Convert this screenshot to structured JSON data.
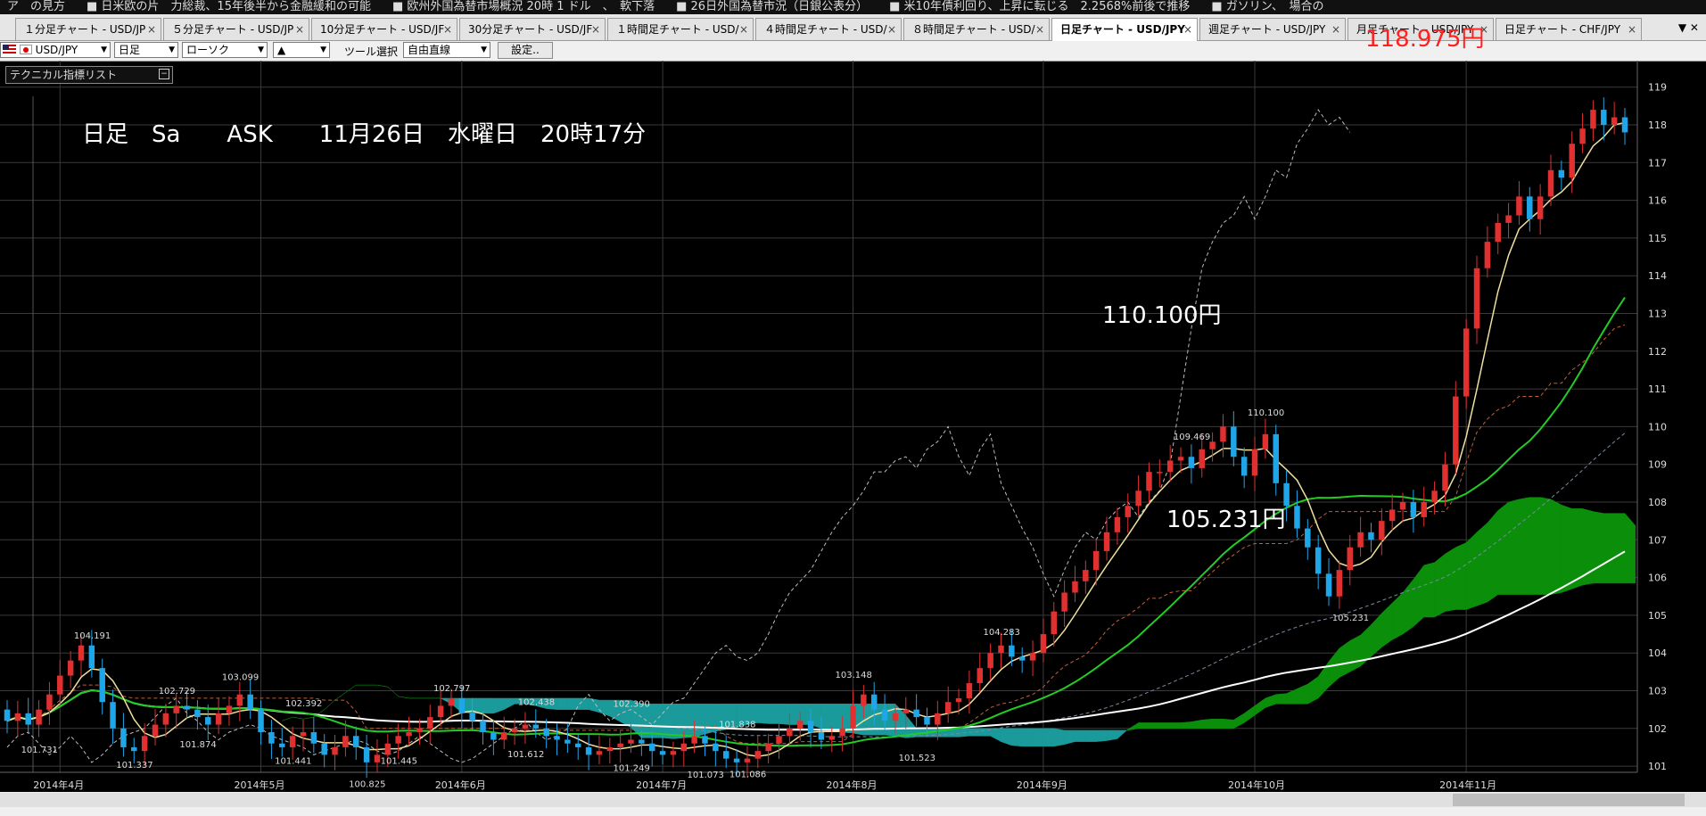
{
  "ticker": [
    "ア　の見方",
    "■ 日米欧の片　力総裁、15年後半から金融緩和の可能",
    "■ 欧州外国為替市場概況 20時 1 ドル　、　軟下落",
    "■ 26日外国為替市況（日銀公表分）",
    "■ 米10年債利回り、上昇に転じる　2.2568%前後で推移",
    "■ ガソリン、　場合の"
  ],
  "tabs": [
    {
      "label": "１分足チャート - USD/JP",
      "active": false
    },
    {
      "label": "５分足チャート - USD/JP",
      "active": false
    },
    {
      "label": "10分足チャート - USD/JF",
      "active": false
    },
    {
      "label": "30分足チャート - USD/JF",
      "active": false
    },
    {
      "label": "１時間足チャート - USD/",
      "active": false
    },
    {
      "label": "４時間足チャート - USD/",
      "active": false
    },
    {
      "label": "８時間足チャート - USD/",
      "active": false
    },
    {
      "label": "日足チャート - USD/JPY",
      "active": true
    },
    {
      "label": "週足チャート - USD/JPY",
      "active": false
    },
    {
      "label": "月足チャート - USD/JPY",
      "active": false
    },
    {
      "label": "日足チャート - CHF/JPY",
      "active": false
    }
  ],
  "tab_close": "×",
  "tab_controls": "▼ ✕",
  "toolbar": {
    "pair": "USD/JPY",
    "period": "日足",
    "chart_kind": "ローソク",
    "style_icon": "▲",
    "tool_label": "ツール選択",
    "tool_value": "自由直線",
    "settings": "設定.."
  },
  "current_price_text": "118.975円",
  "indicator_list": "テクニカル指標リスト",
  "info_line": "日足　Sa　　ASK　　11月26日　水曜日　20時17分",
  "annotations": {
    "high_text": "110.100円",
    "low_text": "105.231円"
  },
  "colors": {
    "background": "#000000",
    "grid": "#3a3a3a",
    "up_candle": "#e03030",
    "down_candle": "#1ea6e8",
    "cloud_green": "#0b8f0b",
    "cloud_teal": "#1a9a9a",
    "ma_short": "#f0e0a0",
    "ma_mid": "#22cc22",
    "ma_long": "#ffffff",
    "current_price": "#ff2020"
  },
  "chart_data": {
    "type": "candlestick",
    "symbol": "USD/JPY",
    "timeframe": "日足",
    "ylim": [
      100.6,
      119.3
    ],
    "yticks": [
      101,
      102,
      103,
      104,
      105,
      106,
      107,
      108,
      109,
      110,
      111,
      112,
      113,
      114,
      115,
      116,
      117,
      118,
      119
    ],
    "month_labels": [
      "2014年4月",
      "2014年5月",
      "2014年6月",
      "2014年7月",
      "2014年8月",
      "2014年9月",
      "2014年10月",
      "2014年11月"
    ],
    "month_start_index": [
      5,
      24,
      43,
      62,
      80,
      98,
      118,
      138
    ],
    "close": [
      102.2,
      102.4,
      102.1,
      102.5,
      102.9,
      103.4,
      103.8,
      104.2,
      103.6,
      102.7,
      102.0,
      101.5,
      101.4,
      101.8,
      102.1,
      102.4,
      102.6,
      102.5,
      102.3,
      102.1,
      102.4,
      102.6,
      102.9,
      102.5,
      101.9,
      101.6,
      101.5,
      101.8,
      101.9,
      101.6,
      101.3,
      101.5,
      101.8,
      101.5,
      101.1,
      101.3,
      101.6,
      101.8,
      101.9,
      102.0,
      102.3,
      102.6,
      102.8,
      102.4,
      102.2,
      101.9,
      101.7,
      101.9,
      102.0,
      102.1,
      102.0,
      101.8,
      101.7,
      101.6,
      101.5,
      101.3,
      101.4,
      101.5,
      101.6,
      101.7,
      101.6,
      101.4,
      101.3,
      101.4,
      101.6,
      101.8,
      101.6,
      101.4,
      101.2,
      101.1,
      101.2,
      101.4,
      101.6,
      101.8,
      102.0,
      102.2,
      101.9,
      101.7,
      101.8,
      102.0,
      102.6,
      102.9,
      102.5,
      102.2,
      102.4,
      102.5,
      102.3,
      102.1,
      102.4,
      102.7,
      102.8,
      103.2,
      103.6,
      104.0,
      104.2,
      103.9,
      103.8,
      104.0,
      104.5,
      105.1,
      105.6,
      105.9,
      106.2,
      106.7,
      107.2,
      107.6,
      107.9,
      108.3,
      108.8,
      108.8,
      109.1,
      109.2,
      108.9,
      109.4,
      109.6,
      110.0,
      109.2,
      108.7,
      109.4,
      109.8,
      108.5,
      107.9,
      107.3,
      106.8,
      106.1,
      105.5,
      106.2,
      106.8,
      107.2,
      107.0,
      107.5,
      107.8,
      108.0,
      107.6,
      108.0,
      108.3,
      109.0,
      110.8,
      112.6,
      114.2,
      114.9,
      115.4,
      115.6,
      116.1,
      115.5,
      116.1,
      116.8,
      116.6,
      117.5,
      117.9,
      118.4,
      118.0,
      118.2,
      117.8
    ],
    "open": [
      102.5,
      102.2,
      102.4,
      102.1,
      102.5,
      102.9,
      103.4,
      103.8,
      104.2,
      103.6,
      102.7,
      102.0,
      101.5,
      101.4,
      101.8,
      102.1,
      102.4,
      102.6,
      102.5,
      102.3,
      102.1,
      102.4,
      102.6,
      102.9,
      102.5,
      101.9,
      101.6,
      101.5,
      101.8,
      101.9,
      101.6,
      101.3,
      101.5,
      101.8,
      101.5,
      101.1,
      101.3,
      101.6,
      101.8,
      101.9,
      102.0,
      102.3,
      102.6,
      102.8,
      102.4,
      102.2,
      101.9,
      101.7,
      101.9,
      102.0,
      102.1,
      102.0,
      101.8,
      101.7,
      101.6,
      101.5,
      101.3,
      101.4,
      101.5,
      101.6,
      101.7,
      101.6,
      101.4,
      101.3,
      101.4,
      101.6,
      101.8,
      101.6,
      101.4,
      101.2,
      101.1,
      101.2,
      101.4,
      101.6,
      101.8,
      102.0,
      102.2,
      101.9,
      101.7,
      101.8,
      102.0,
      102.6,
      102.9,
      102.5,
      102.2,
      102.4,
      102.5,
      102.3,
      102.1,
      102.4,
      102.7,
      102.8,
      103.2,
      103.6,
      104.0,
      104.2,
      103.9,
      103.8,
      104.0,
      104.5,
      105.1,
      105.6,
      105.9,
      106.2,
      106.7,
      107.2,
      107.6,
      107.9,
      108.3,
      108.8,
      108.8,
      109.1,
      109.2,
      108.9,
      109.4,
      109.6,
      110.0,
      109.2,
      108.7,
      109.4,
      109.8,
      108.5,
      107.9,
      107.3,
      106.8,
      106.1,
      105.5,
      106.2,
      106.8,
      107.2,
      107.0,
      107.5,
      107.8,
      108.0,
      107.6,
      108.0,
      108.3,
      109.0,
      110.8,
      112.6,
      114.2,
      114.9,
      115.4,
      115.6,
      116.1,
      115.5,
      116.1,
      116.8,
      116.6,
      117.5,
      117.9,
      118.4,
      118.0,
      118.2
    ],
    "price_labels": [
      {
        "i": 8,
        "value": "104.191",
        "pos": "above"
      },
      {
        "i": 3,
        "value": "101.731",
        "pos": "below"
      },
      {
        "i": 12,
        "value": "101.337",
        "pos": "below"
      },
      {
        "i": 16,
        "value": "102.729",
        "pos": "above"
      },
      {
        "i": 18,
        "value": "101.874",
        "pos": "below"
      },
      {
        "i": 22,
        "value": "103.099",
        "pos": "above"
      },
      {
        "i": 27,
        "value": "101.441",
        "pos": "below"
      },
      {
        "i": 28,
        "value": "102.392",
        "pos": "above"
      },
      {
        "i": 34,
        "value": "100.825",
        "pos": "below"
      },
      {
        "i": 37,
        "value": "101.445",
        "pos": "below"
      },
      {
        "i": 42,
        "value": "102.797",
        "pos": "above"
      },
      {
        "i": 50,
        "value": "102.438",
        "pos": "above"
      },
      {
        "i": 49,
        "value": "101.612",
        "pos": "below"
      },
      {
        "i": 59,
        "value": "102.390",
        "pos": "above"
      },
      {
        "i": 59,
        "value": "101.249",
        "pos": "below"
      },
      {
        "i": 66,
        "value": "101.073",
        "pos": "below"
      },
      {
        "i": 69,
        "value": "101.838",
        "pos": "above"
      },
      {
        "i": 70,
        "value": "101.086",
        "pos": "below"
      },
      {
        "i": 80,
        "value": "103.148",
        "pos": "above"
      },
      {
        "i": 86,
        "value": "101.523",
        "pos": "below"
      },
      {
        "i": 94,
        "value": "104.283",
        "pos": "above"
      },
      {
        "i": 112,
        "value": "109.469",
        "pos": "above"
      },
      {
        "i": 119,
        "value": "110.100",
        "pos": "above"
      },
      {
        "i": 127,
        "value": "105.231",
        "pos": "below"
      }
    ]
  }
}
